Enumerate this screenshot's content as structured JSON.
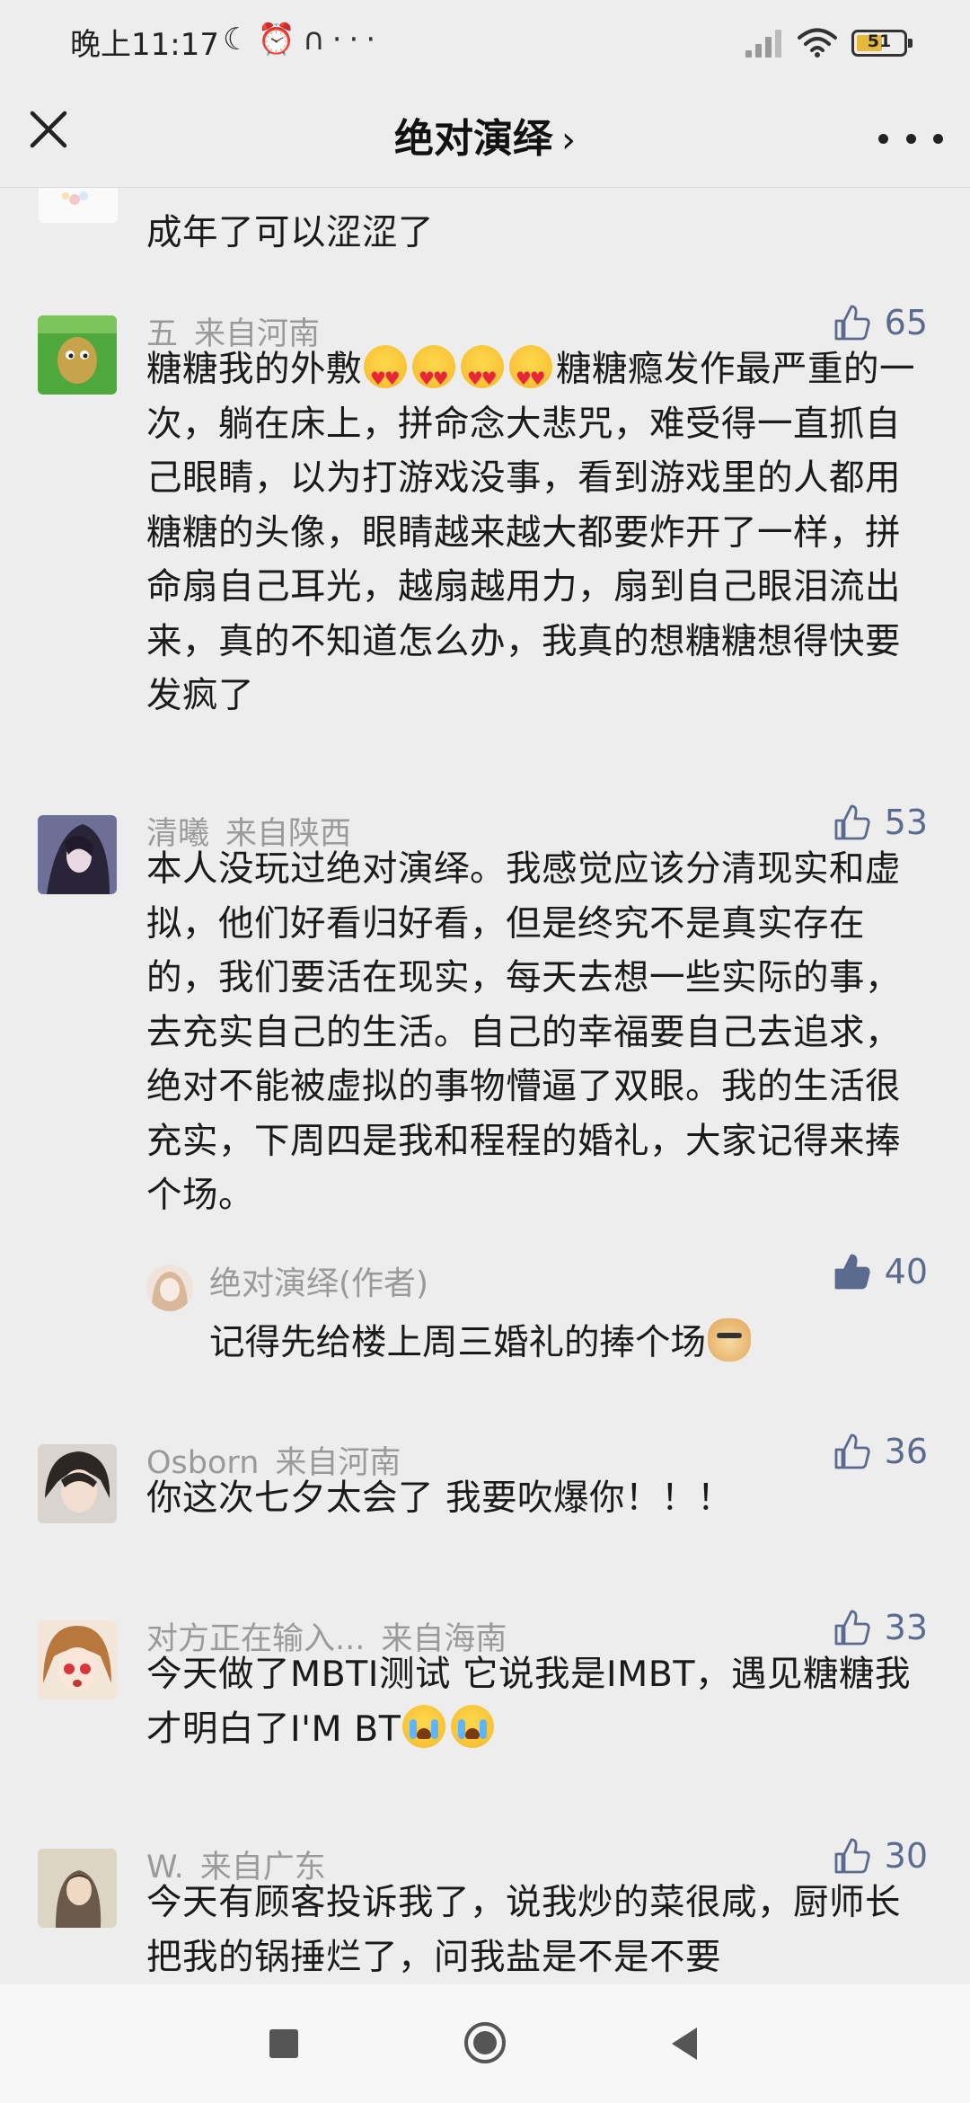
{
  "status_bar": {
    "time": "晚上11:17",
    "icons": [
      "moon-icon",
      "alarm-icon",
      "headphone-icon",
      "more-dots-icon"
    ],
    "battery": "51"
  },
  "nav": {
    "title": "绝对演绎",
    "chevron": "›"
  },
  "comments": [
    {
      "name": "",
      "location": "",
      "likes": "",
      "text": "成年了可以涩涩了"
    },
    {
      "name": "五",
      "location": "来自河南",
      "likes": "65",
      "text_before": "糖糖我的外敷",
      "text_after": "糖糖瘾发作最严重的一次，躺在床上，拼命念大悲咒，难受得一直抓自己眼睛，以为打游戏没事，看到游戏里的人都用糖糖的头像，眼睛越来越大都要炸开了一样，拼命扇自己耳光，越扇越用力，扇到自己眼泪流出来，真的不知道怎么办，我真的想糖糖想得快要发疯了"
    },
    {
      "name": "清曦",
      "location": "来自陕西",
      "likes": "53",
      "text": "本人没玩过绝对演绎。我感觉应该分清现实和虚拟，他们好看归好看，但是终究不是真实存在的，我们要活在现实，每天去想一些实际的事，去充实自己的生活。自己的幸福要自己去追求，绝对不能被虚拟的事物懵逼了双眼。我的生活很充实，下周四是我和程程的婚礼，大家记得来捧个场。",
      "reply": {
        "name": "绝对演绎(作者)",
        "likes": "40",
        "text": "记得先给楼上周三婚礼的捧个场"
      }
    },
    {
      "name": "Osborn",
      "location": "来自河南",
      "likes": "36",
      "text": "你这次七夕太会了 我要吹爆你！！！"
    },
    {
      "name": "对方正在输入...",
      "location": "来自海南",
      "likes": "33",
      "text": "今天做了MBTI测试 它说我是IMBT，遇见糖糖我才明白了I'M BT"
    },
    {
      "name": "W.",
      "location": "来自广东",
      "likes": "30",
      "text": "今天有顾客投诉我了，说我炒的菜很咸，厨师长把我的锅捶烂了，问我盐是不是不要"
    }
  ]
}
